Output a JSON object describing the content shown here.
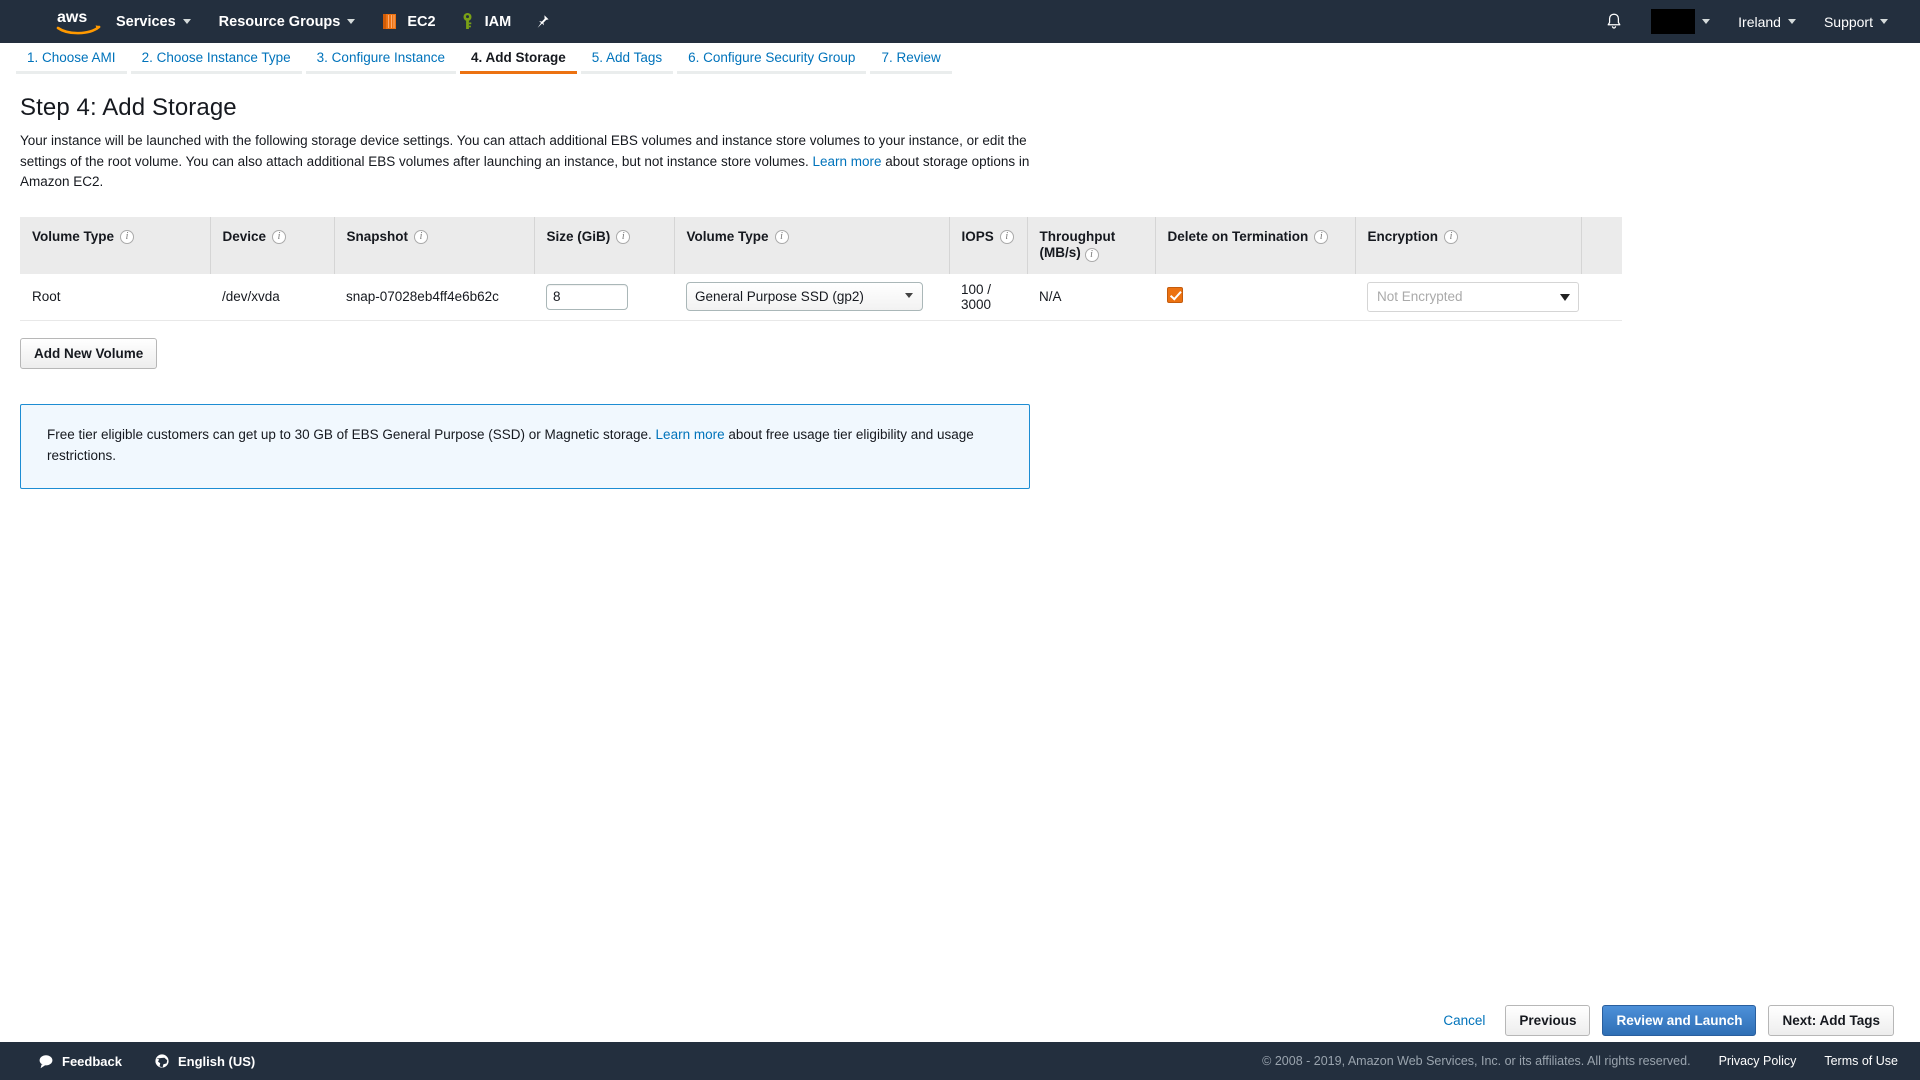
{
  "topnav": {
    "logo_alt": "aws",
    "services_label": "Services",
    "resource_groups_label": "Resource Groups",
    "shortcuts": [
      {
        "label": "EC2",
        "icon": "ec2-cube-icon"
      },
      {
        "label": "IAM",
        "icon": "iam-key-icon"
      }
    ],
    "pin_icon": "pushpin-icon",
    "bell_icon": "notifications-bell-icon",
    "account_label": "",
    "region_label": "Ireland",
    "support_label": "Support"
  },
  "wizard": {
    "tabs": [
      {
        "label": "1. Choose AMI",
        "active": false
      },
      {
        "label": "2. Choose Instance Type",
        "active": false
      },
      {
        "label": "3. Configure Instance",
        "active": false
      },
      {
        "label": "4. Add Storage",
        "active": true
      },
      {
        "label": "5. Add Tags",
        "active": false
      },
      {
        "label": "6. Configure Security Group",
        "active": false
      },
      {
        "label": "7. Review",
        "active": false
      }
    ]
  },
  "page": {
    "title": "Step 4: Add Storage",
    "desc_part1": "Your instance will be launched with the following storage device settings. You can attach additional EBS volumes and instance store volumes to your instance, or edit the settings of the root volume. You can also attach additional EBS volumes after launching an instance, but not instance store volumes. ",
    "desc_link": "Learn more",
    "desc_part2": " about storage options in Amazon EC2."
  },
  "table": {
    "headers": [
      "Volume Type",
      "Device",
      "Snapshot",
      "Size (GiB)",
      "Volume Type",
      "IOPS",
      "Throughput (MB/s)",
      "Delete on Termination",
      "Encryption"
    ],
    "throughput_line1": "Throughput",
    "throughput_line2": "(MB/s)",
    "rows": [
      {
        "volume_type": "Root",
        "device": "/dev/xvda",
        "snapshot": "snap-07028eb4ff4e6b62c",
        "size": "8",
        "volume_type_select": "General Purpose SSD (gp2)",
        "iops": "100 / 3000",
        "throughput": "N/A",
        "delete_on_termination": true,
        "encryption": "Not Encrypted"
      }
    ]
  },
  "actions": {
    "add_new_volume": "Add New Volume",
    "cancel": "Cancel",
    "previous": "Previous",
    "review_and_launch": "Review and Launch",
    "next": "Next: Add Tags"
  },
  "free_tier": {
    "part1": "Free tier eligible customers can get up to 30 GB of EBS General Purpose (SSD) or Magnetic storage. ",
    "link": "Learn more",
    "part2": " about free usage tier eligibility and usage restrictions."
  },
  "bottombar": {
    "feedback": "Feedback",
    "language": "English (US)",
    "copyright": "© 2008 - 2019, Amazon Web Services, Inc. or its affiliates. All rights reserved.",
    "privacy": "Privacy Policy",
    "terms": "Terms of Use"
  },
  "colors": {
    "nav_bg": "#232f3e",
    "accent_orange": "#ec7211",
    "link_blue": "#0073bb",
    "primary_button": "#2f6fb5",
    "alert_border": "#1d8dd3",
    "alert_bg": "#f1f8fe"
  }
}
